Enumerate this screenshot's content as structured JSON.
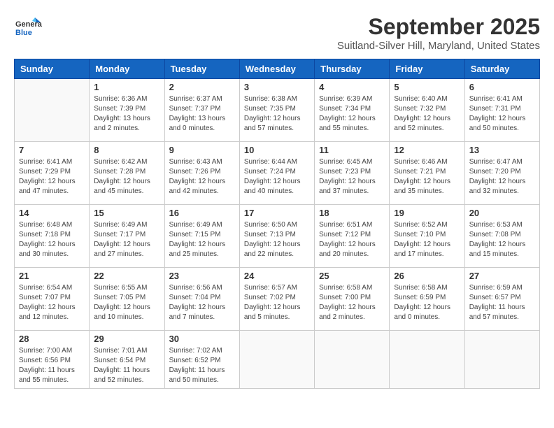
{
  "header": {
    "logo_general": "General",
    "logo_blue": "Blue",
    "month_title": "September 2025",
    "location": "Suitland-Silver Hill, Maryland, United States"
  },
  "days_of_week": [
    "Sunday",
    "Monday",
    "Tuesday",
    "Wednesday",
    "Thursday",
    "Friday",
    "Saturday"
  ],
  "weeks": [
    [
      {
        "day": "",
        "empty": true
      },
      {
        "day": "1",
        "sunrise": "6:36 AM",
        "sunset": "7:39 PM",
        "daylight": "13 hours and 2 minutes."
      },
      {
        "day": "2",
        "sunrise": "6:37 AM",
        "sunset": "7:37 PM",
        "daylight": "13 hours and 0 minutes."
      },
      {
        "day": "3",
        "sunrise": "6:38 AM",
        "sunset": "7:35 PM",
        "daylight": "12 hours and 57 minutes."
      },
      {
        "day": "4",
        "sunrise": "6:39 AM",
        "sunset": "7:34 PM",
        "daylight": "12 hours and 55 minutes."
      },
      {
        "day": "5",
        "sunrise": "6:40 AM",
        "sunset": "7:32 PM",
        "daylight": "12 hours and 52 minutes."
      },
      {
        "day": "6",
        "sunrise": "6:41 AM",
        "sunset": "7:31 PM",
        "daylight": "12 hours and 50 minutes."
      }
    ],
    [
      {
        "day": "7",
        "sunrise": "6:41 AM",
        "sunset": "7:29 PM",
        "daylight": "12 hours and 47 minutes."
      },
      {
        "day": "8",
        "sunrise": "6:42 AM",
        "sunset": "7:28 PM",
        "daylight": "12 hours and 45 minutes."
      },
      {
        "day": "9",
        "sunrise": "6:43 AM",
        "sunset": "7:26 PM",
        "daylight": "12 hours and 42 minutes."
      },
      {
        "day": "10",
        "sunrise": "6:44 AM",
        "sunset": "7:24 PM",
        "daylight": "12 hours and 40 minutes."
      },
      {
        "day": "11",
        "sunrise": "6:45 AM",
        "sunset": "7:23 PM",
        "daylight": "12 hours and 37 minutes."
      },
      {
        "day": "12",
        "sunrise": "6:46 AM",
        "sunset": "7:21 PM",
        "daylight": "12 hours and 35 minutes."
      },
      {
        "day": "13",
        "sunrise": "6:47 AM",
        "sunset": "7:20 PM",
        "daylight": "12 hours and 32 minutes."
      }
    ],
    [
      {
        "day": "14",
        "sunrise": "6:48 AM",
        "sunset": "7:18 PM",
        "daylight": "12 hours and 30 minutes."
      },
      {
        "day": "15",
        "sunrise": "6:49 AM",
        "sunset": "7:17 PM",
        "daylight": "12 hours and 27 minutes."
      },
      {
        "day": "16",
        "sunrise": "6:49 AM",
        "sunset": "7:15 PM",
        "daylight": "12 hours and 25 minutes."
      },
      {
        "day": "17",
        "sunrise": "6:50 AM",
        "sunset": "7:13 PM",
        "daylight": "12 hours and 22 minutes."
      },
      {
        "day": "18",
        "sunrise": "6:51 AM",
        "sunset": "7:12 PM",
        "daylight": "12 hours and 20 minutes."
      },
      {
        "day": "19",
        "sunrise": "6:52 AM",
        "sunset": "7:10 PM",
        "daylight": "12 hours and 17 minutes."
      },
      {
        "day": "20",
        "sunrise": "6:53 AM",
        "sunset": "7:08 PM",
        "daylight": "12 hours and 15 minutes."
      }
    ],
    [
      {
        "day": "21",
        "sunrise": "6:54 AM",
        "sunset": "7:07 PM",
        "daylight": "12 hours and 12 minutes."
      },
      {
        "day": "22",
        "sunrise": "6:55 AM",
        "sunset": "7:05 PM",
        "daylight": "12 hours and 10 minutes."
      },
      {
        "day": "23",
        "sunrise": "6:56 AM",
        "sunset": "7:04 PM",
        "daylight": "12 hours and 7 minutes."
      },
      {
        "day": "24",
        "sunrise": "6:57 AM",
        "sunset": "7:02 PM",
        "daylight": "12 hours and 5 minutes."
      },
      {
        "day": "25",
        "sunrise": "6:58 AM",
        "sunset": "7:00 PM",
        "daylight": "12 hours and 2 minutes."
      },
      {
        "day": "26",
        "sunrise": "6:58 AM",
        "sunset": "6:59 PM",
        "daylight": "12 hours and 0 minutes."
      },
      {
        "day": "27",
        "sunrise": "6:59 AM",
        "sunset": "6:57 PM",
        "daylight": "11 hours and 57 minutes."
      }
    ],
    [
      {
        "day": "28",
        "sunrise": "7:00 AM",
        "sunset": "6:56 PM",
        "daylight": "11 hours and 55 minutes."
      },
      {
        "day": "29",
        "sunrise": "7:01 AM",
        "sunset": "6:54 PM",
        "daylight": "11 hours and 52 minutes."
      },
      {
        "day": "30",
        "sunrise": "7:02 AM",
        "sunset": "6:52 PM",
        "daylight": "11 hours and 50 minutes."
      },
      {
        "day": "",
        "empty": true
      },
      {
        "day": "",
        "empty": true
      },
      {
        "day": "",
        "empty": true
      },
      {
        "day": "",
        "empty": true
      }
    ]
  ]
}
